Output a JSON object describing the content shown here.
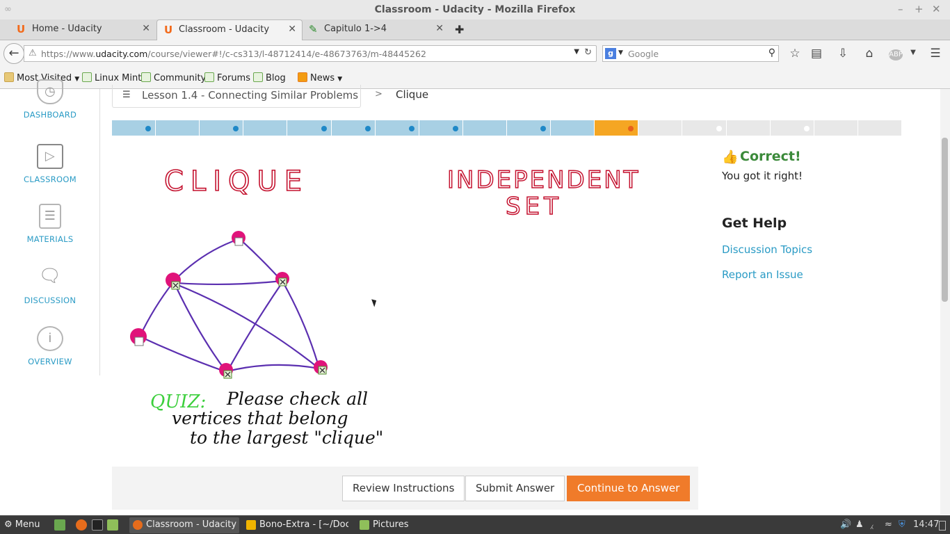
{
  "window": {
    "title": "Classroom - Udacity - Mozilla Firefox"
  },
  "tabs": [
    {
      "label": "Home - Udacity",
      "active": false
    },
    {
      "label": "Classroom - Udacity",
      "active": true
    },
    {
      "label": "Capitulo 1->4",
      "active": false
    }
  ],
  "url": {
    "prefix": "https://www.",
    "domain": "udacity.com",
    "path": "/course/viewer#!/c-cs313/l-48712414/e-48673763/m-48445262"
  },
  "search": {
    "placeholder": "Google"
  },
  "bookmarks": [
    {
      "label": "Most Visited",
      "dropdown": true
    },
    {
      "label": "Linux Mint"
    },
    {
      "label": "Community"
    },
    {
      "label": "Forums"
    },
    {
      "label": "Blog"
    },
    {
      "label": "News",
      "dropdown": true
    }
  ],
  "sidebar": {
    "items": [
      {
        "label": "DASHBOARD",
        "icon": "dashboard-icon"
      },
      {
        "label": "CLASSROOM",
        "icon": "play-icon"
      },
      {
        "label": "MATERIALS",
        "icon": "document-icon"
      },
      {
        "label": "DISCUSSION",
        "icon": "chat-bubbles-icon"
      },
      {
        "label": "OVERVIEW",
        "icon": "info-icon"
      }
    ]
  },
  "breadcrumb": {
    "lesson": "Lesson 1.4 - Connecting Similar Problems",
    "separator": ">",
    "current": "Clique"
  },
  "progress": {
    "total_segments": 18,
    "current_segment": 12,
    "completed_segments": 11
  },
  "drawing": {
    "heading_left": "CLIQUE",
    "heading_right_line1": "INDEPENDENT",
    "heading_right_line2": "SET",
    "quiz_label": "QUIZ:",
    "quiz_line1": "Please check all",
    "quiz_line2": "vertices that belong",
    "quiz_line3": "to the largest \"clique\""
  },
  "feedback": {
    "title": "Correct!",
    "message": "You got it right!"
  },
  "help": {
    "title": "Get Help",
    "links": [
      "Discussion Topics",
      "Report an Issue"
    ]
  },
  "actions": {
    "review": "Review Instructions",
    "submit": "Submit Answer",
    "continue": "Continue to Answer"
  },
  "taskbar": {
    "menu": "Menu",
    "tasks": [
      {
        "label": "Classroom - Udacity -...",
        "active": true
      },
      {
        "label": "Bono-Extra - [~/Docu...",
        "active": false
      },
      {
        "label": "Pictures",
        "active": false
      }
    ],
    "clock": "14:47"
  },
  "colors": {
    "accent": "#2a9bc5",
    "correct": "#3b8a3a",
    "primary_button": "#f07b2a",
    "progress_done": "#a8d0e4",
    "progress_current": "#f5a623",
    "ink_red": "#c4122f",
    "ink_purple": "#5b2fb0",
    "ink_green": "#3ccf3c"
  }
}
